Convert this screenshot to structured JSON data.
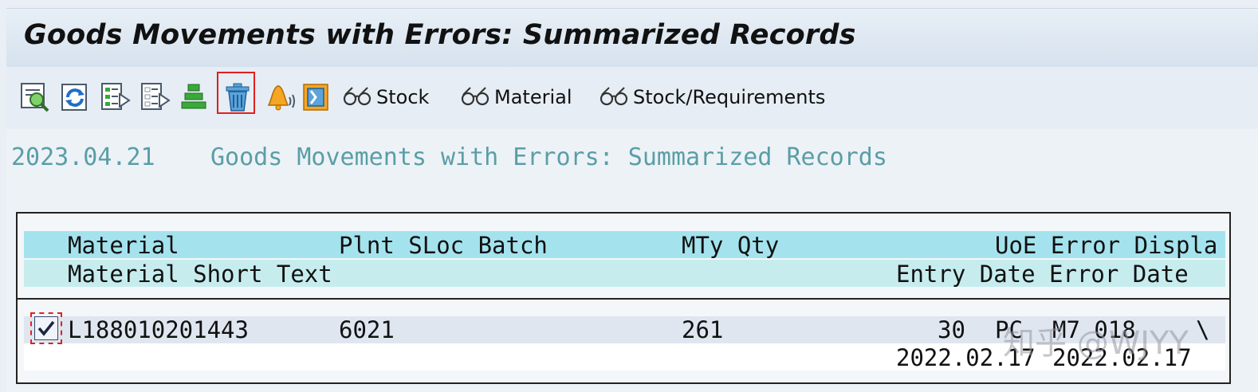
{
  "window": {
    "title": "Goods Movements with Errors: Summarized Records"
  },
  "toolbar": {
    "icons": [
      {
        "name": "detail-icon",
        "selected": false
      },
      {
        "name": "refresh-icon",
        "selected": false
      },
      {
        "name": "select-all-icon",
        "selected": false
      },
      {
        "name": "deselect-all-icon",
        "selected": false
      },
      {
        "name": "sort-icon",
        "selected": false
      },
      {
        "name": "delete-icon",
        "selected": true
      },
      {
        "name": "notification-bell-icon",
        "selected": false
      },
      {
        "name": "bookmark-icon",
        "selected": false
      }
    ],
    "stock_label": "Stock",
    "material_label": "Material",
    "stock_req_label": "Stock/Requirements",
    "accent_color": "#e02020"
  },
  "report": {
    "date": "2023.04.21",
    "title": "Goods Movements with Errors: Summarized Records"
  },
  "list": {
    "headers_row1": {
      "material": "Material",
      "plnt_sloc_batch": "Plnt SLoc Batch",
      "mty_qty": "MTy Qty",
      "uoe_error_displa": "UoE Error Displa"
    },
    "headers_row2": {
      "short_text": "Material Short Text",
      "entry_error_date": "Entry Date Error Date"
    },
    "rows": [
      {
        "checked": true,
        "material": "L188010201443",
        "plant": "6021",
        "mvt_type": "261",
        "qty": "30",
        "uoe_partial": "PC",
        "error_partial": "M7 018",
        "displa_partial": "\\",
        "entry_date": "2022.02.17",
        "error_date": "2022.02.17"
      }
    ]
  },
  "watermark": "知乎 @WJYY"
}
